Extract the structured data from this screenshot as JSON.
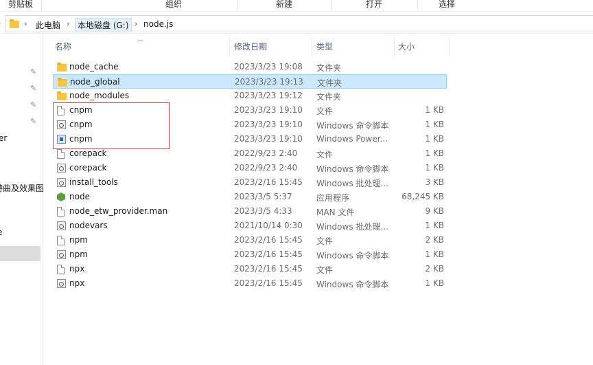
{
  "ribbon": {
    "groups": [
      {
        "label": "剪贴板"
      },
      {
        "label": "组织"
      },
      {
        "label": "新建"
      },
      {
        "label": "打开"
      },
      {
        "label": "选择"
      }
    ]
  },
  "address": {
    "crumbs": [
      "此电脑",
      "本地磁盘 (G:)",
      "node.js"
    ]
  },
  "nav": {
    "items": [
      "er",
      "特曲及效果图",
      "e"
    ]
  },
  "columns": {
    "name": "名称",
    "date": "修改日期",
    "type": "类型",
    "size": "大小"
  },
  "files": [
    {
      "name": "node_cache",
      "date": "2023/3/23 19:08",
      "type": "文件夹",
      "size": "",
      "icon": "folder-icon"
    },
    {
      "name": "node_global",
      "date": "2023/3/23 19:13",
      "type": "文件夹",
      "size": "",
      "icon": "folder-icon"
    },
    {
      "name": "node_modules",
      "date": "2023/3/23 19:12",
      "type": "文件夹",
      "size": "",
      "icon": "folder-icon"
    },
    {
      "name": "cnpm",
      "date": "2023/3/23 19:10",
      "type": "文件",
      "size": "1 KB",
      "icon": "file-icon"
    },
    {
      "name": "cnpm",
      "date": "2023/3/23 19:10",
      "type": "Windows 命令脚本",
      "size": "1 KB",
      "icon": "script-icon"
    },
    {
      "name": "cnpm",
      "date": "2023/3/23 19:10",
      "type": "Windows Power...",
      "size": "1 KB",
      "icon": "powershell-icon"
    },
    {
      "name": "corepack",
      "date": "2022/9/23 2:40",
      "type": "文件",
      "size": "1 KB",
      "icon": "file-icon"
    },
    {
      "name": "corepack",
      "date": "2022/9/23 2:40",
      "type": "Windows 命令脚本",
      "size": "1 KB",
      "icon": "script-icon"
    },
    {
      "name": "install_tools",
      "date": "2023/2/16 15:45",
      "type": "Windows 批处理...",
      "size": "3 KB",
      "icon": "script-icon"
    },
    {
      "name": "node",
      "date": "2023/3/5 5:37",
      "type": "应用程序",
      "size": "68,245 KB",
      "icon": "node-icon"
    },
    {
      "name": "node_etw_provider.man",
      "date": "2023/3/5 4:33",
      "type": "MAN 文件",
      "size": "9 KB",
      "icon": "file-icon"
    },
    {
      "name": "nodevars",
      "date": "2021/10/14 0:30",
      "type": "Windows 批处理...",
      "size": "1 KB",
      "icon": "script-icon"
    },
    {
      "name": "npm",
      "date": "2023/2/16 15:45",
      "type": "文件",
      "size": "2 KB",
      "icon": "file-icon"
    },
    {
      "name": "npm",
      "date": "2023/2/16 15:45",
      "type": "Windows 命令脚本",
      "size": "1 KB",
      "icon": "script-icon"
    },
    {
      "name": "npx",
      "date": "2023/2/16 15:45",
      "type": "文件",
      "size": "2 KB",
      "icon": "file-icon"
    },
    {
      "name": "npx",
      "date": "2023/2/16 15:45",
      "type": "Windows 命令脚本",
      "size": "1 KB",
      "icon": "script-icon"
    }
  ],
  "colors": {
    "selection": "#cce8ff",
    "folder": "#f4c542",
    "highlight_box": "#d04040"
  }
}
